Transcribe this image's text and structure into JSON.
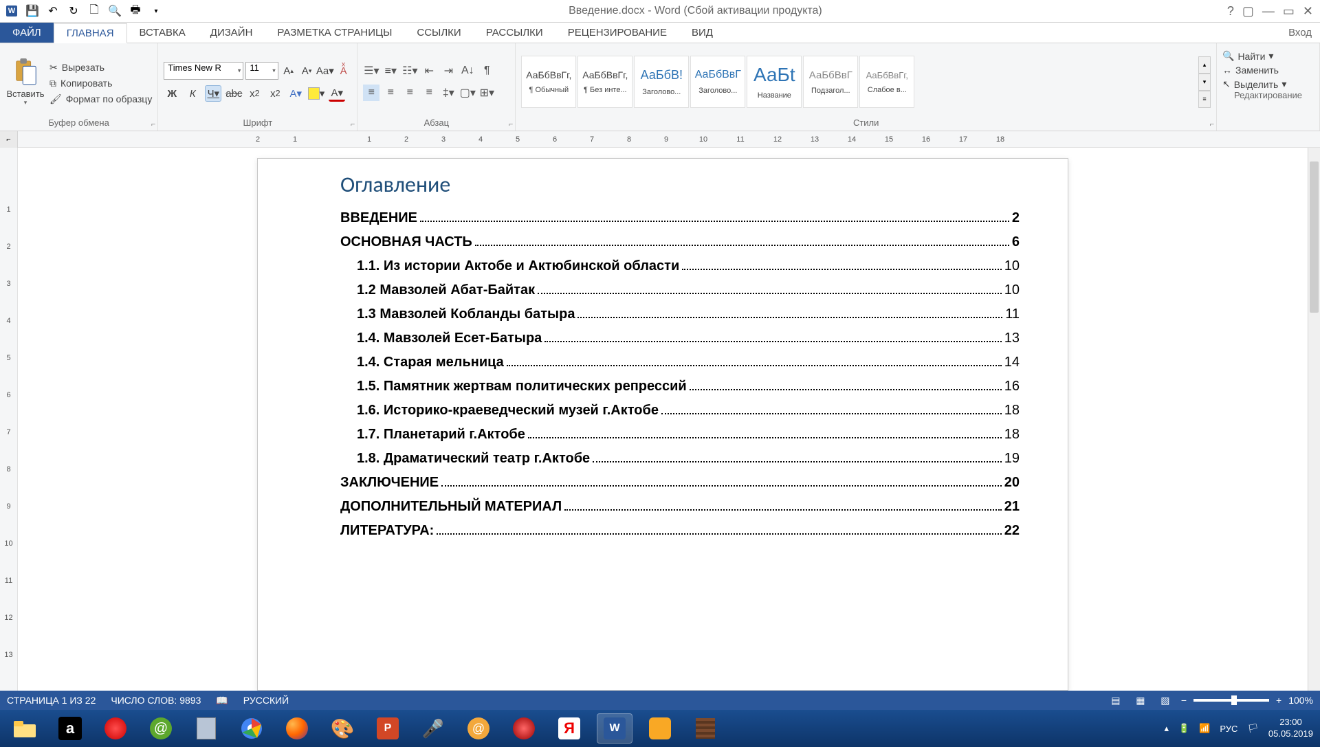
{
  "title": "Введение.docx - Word (Сбой активации продукта)",
  "tabs": {
    "file": "ФАЙЛ",
    "home": "ГЛАВНАЯ",
    "insert": "ВСТАВКА",
    "design": "ДИЗАЙН",
    "layout": "РАЗМЕТКА СТРАНИЦЫ",
    "references": "ССЫЛКИ",
    "mailings": "РАССЫЛКИ",
    "review": "РЕЦЕНЗИРОВАНИЕ",
    "view": "ВИД",
    "signin": "Вход"
  },
  "clipboard": {
    "paste": "Вставить",
    "cut": "Вырезать",
    "copy": "Копировать",
    "format": "Формат по образцу",
    "group": "Буфер обмена"
  },
  "font": {
    "name": "Times New R",
    "size": "11",
    "group": "Шрифт"
  },
  "paragraph": {
    "group": "Абзац"
  },
  "styles": {
    "group": "Стили",
    "list": [
      {
        "preview": "АаБбВвГг,",
        "label": "¶ Обычный"
      },
      {
        "preview": "АаБбВвГг,",
        "label": "¶ Без инте..."
      },
      {
        "preview": "АаБбВ!",
        "label": "Заголово..."
      },
      {
        "preview": "АаБбВвГ",
        "label": "Заголово..."
      },
      {
        "preview": "АаБt",
        "label": "Название"
      },
      {
        "preview": "АаБбВвГ",
        "label": "Подзагол..."
      },
      {
        "preview": "АаБбВвГг,",
        "label": "Слабое в..."
      }
    ]
  },
  "editing": {
    "find": "Найти",
    "replace": "Заменить",
    "select": "Выделить",
    "group": "Редактирование"
  },
  "ruler_h": [
    "2",
    "1",
    "",
    "1",
    "2",
    "3",
    "4",
    "5",
    "6",
    "7",
    "8",
    "9",
    "10",
    "11",
    "12",
    "13",
    "14",
    "15",
    "16",
    "17",
    "18"
  ],
  "ruler_v": [
    "",
    "1",
    "2",
    "3",
    "4",
    "5",
    "6",
    "7",
    "8",
    "9",
    "10",
    "11",
    "12",
    "13"
  ],
  "doc": {
    "toc_title": "Оглавление",
    "entries": [
      {
        "level": 1,
        "text": "ВВЕДЕНИЕ",
        "page": "2"
      },
      {
        "level": 1,
        "text": "ОСНОВНАЯ ЧАСТЬ",
        "page": "6"
      },
      {
        "level": 2,
        "text": "1.1. Из истории Актобе и Актюбинской области",
        "page": "10"
      },
      {
        "level": 2,
        "text": "1.2 Мавзолей Абат-Байтак",
        "page": "10"
      },
      {
        "level": 2,
        "text": "1.3 Мавзолей Кобланды батыра",
        "page": "11"
      },
      {
        "level": 2,
        "text": "1.4. Мавзолей Есет-Батыра",
        "page": "13"
      },
      {
        "level": 2,
        "text": "1.4. Старая мельница",
        "page": "14"
      },
      {
        "level": 2,
        "text": "1.5. Памятник жертвам политических репрессий",
        "page": "16"
      },
      {
        "level": 2,
        "text": "1.6. Историко-краеведческий музей г.Актобе",
        "page": "18"
      },
      {
        "level": 2,
        "text": "1.7. Планетарий г.Актобе",
        "page": "18"
      },
      {
        "level": 2,
        "text": "1.8. Драматический театр г.Актобе",
        "page": "19"
      },
      {
        "level": 1,
        "text": "ЗАКЛЮЧЕНИЕ",
        "page": "20"
      },
      {
        "level": 1,
        "text": "ДОПОЛНИТЕЛЬНЫЙ МАТЕРИАЛ",
        "page": "21"
      },
      {
        "level": 1,
        "text": "ЛИТЕРАТУРА:",
        "page": "22"
      }
    ]
  },
  "status": {
    "page": "СТРАНИЦА 1 ИЗ 22",
    "words": "ЧИСЛО СЛОВ: 9893",
    "lang": "РУССКИЙ",
    "zoom": "100%"
  },
  "tray": {
    "lang": "РУС",
    "time": "23:00",
    "date": "05.05.2019"
  }
}
